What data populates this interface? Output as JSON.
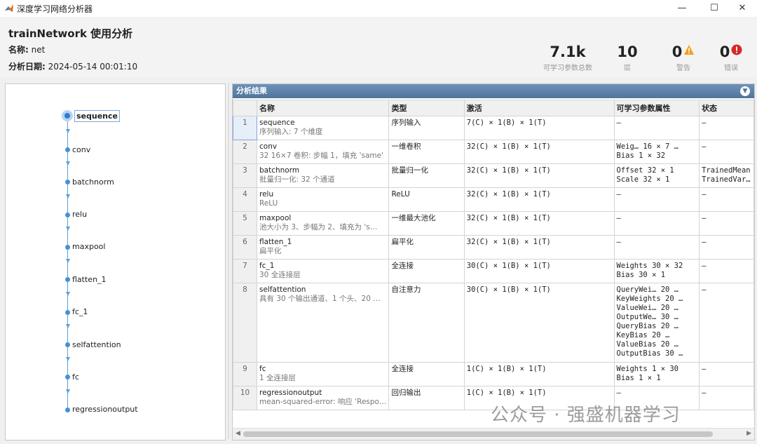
{
  "window": {
    "title": "深度学习网络分析器",
    "minimize": "—",
    "maximize": "☐",
    "close": "✕"
  },
  "header": {
    "title": "trainNetwork 使用分析",
    "name_label": "名称:",
    "name_value": "net",
    "date_label": "分析日期:",
    "date_value": "2024-05-14 00:01:10"
  },
  "stats": [
    {
      "value": "7.1k",
      "label": "可学习参数总数"
    },
    {
      "value": "10",
      "label": "层"
    },
    {
      "value": "0",
      "label": "警告",
      "icon": "warning-icon",
      "color": "#f0a018"
    },
    {
      "value": "0",
      "label": "错误",
      "icon": "error-icon",
      "color": "#d42a2a"
    }
  ],
  "graph": {
    "selected": "sequence",
    "nodes": [
      "sequence",
      "conv",
      "batchnorm",
      "relu",
      "maxpool",
      "flatten_1",
      "fc_1",
      "selfattention",
      "fc",
      "regressionoutput"
    ]
  },
  "results": {
    "title": "分析结果",
    "columns": [
      "",
      "名称",
      "类型",
      "激活",
      "可学习参数属性",
      "状态"
    ],
    "rows": [
      {
        "idx": "1",
        "name": "sequence",
        "desc": "序列输入: 7 个维度",
        "type": "序列输入",
        "act": "7(C) × 1(B) × 1(T)",
        "params": [
          "–"
        ],
        "status": [
          "–"
        ]
      },
      {
        "idx": "2",
        "name": "conv",
        "desc": "32 16×7 卷积: 步幅 1，填充 'same'",
        "type": "一维卷积",
        "act": "32(C) × 1(B) × 1(T)",
        "params": [
          "Weig…  16 × 7 …",
          "Bias    1 × 32"
        ],
        "status": [
          "–"
        ]
      },
      {
        "idx": "3",
        "name": "batchnorm",
        "desc": "批量归一化: 32 个通道",
        "type": "批量归一化",
        "act": "32(C) × 1(B) × 1(T)",
        "params": [
          "Offset  32 × 1",
          "Scale   32 × 1"
        ],
        "status": [
          "TrainedMean",
          "TrainedVar…"
        ]
      },
      {
        "idx": "4",
        "name": "relu",
        "desc": "ReLU",
        "type": "ReLU",
        "act": "32(C) × 1(B) × 1(T)",
        "params": [
          "–"
        ],
        "status": [
          "–"
        ]
      },
      {
        "idx": "5",
        "name": "maxpool",
        "desc": "池大小为 3、步幅为 2、填充为 's…",
        "type": "一维最大池化",
        "act": "32(C) × 1(B) × 1(T)",
        "params": [
          "–"
        ],
        "status": [
          "–"
        ]
      },
      {
        "idx": "6",
        "name": "flatten_1",
        "desc": "扁平化",
        "type": "扁平化",
        "act": "32(C) × 1(B) × 1(T)",
        "params": [
          "–"
        ],
        "status": [
          "–"
        ]
      },
      {
        "idx": "7",
        "name": "fc_1",
        "desc": "30 全连接层",
        "type": "全连接",
        "act": "30(C) × 1(B) × 1(T)",
        "params": [
          "Weights  30 × 32",
          "Bias     30 × 1"
        ],
        "status": [
          "–"
        ]
      },
      {
        "idx": "8",
        "name": "selfattention",
        "desc": "具有 30 个输出通道、1 个头、20 …",
        "type": "自注意力",
        "act": "30(C) × 1(B) × 1(T)",
        "params": [
          "QueryWei…  20 …",
          "KeyWeights  20 …",
          "ValueWei…  20 …",
          "OutputWe…  30 …",
          "QueryBias   20 …",
          "KeyBias     20 …",
          "ValueBias   20 …",
          "OutputBias  30 …"
        ],
        "status": [
          "–"
        ]
      },
      {
        "idx": "9",
        "name": "fc",
        "desc": "1 全连接层",
        "type": "全连接",
        "act": "1(C) × 1(B) × 1(T)",
        "params": [
          "Weights  1 × 30",
          "Bias     1 × 1"
        ],
        "status": [
          "–"
        ]
      },
      {
        "idx": "10",
        "name": "regressionoutput",
        "desc": "mean-squared-error: 响应 'Respo…",
        "type": "回归输出",
        "act": "1(C) × 1(B) × 1(T)",
        "params": [
          "–"
        ],
        "status": [
          "–"
        ]
      }
    ]
  },
  "watermark": "公众号 · 强盛机器学习"
}
